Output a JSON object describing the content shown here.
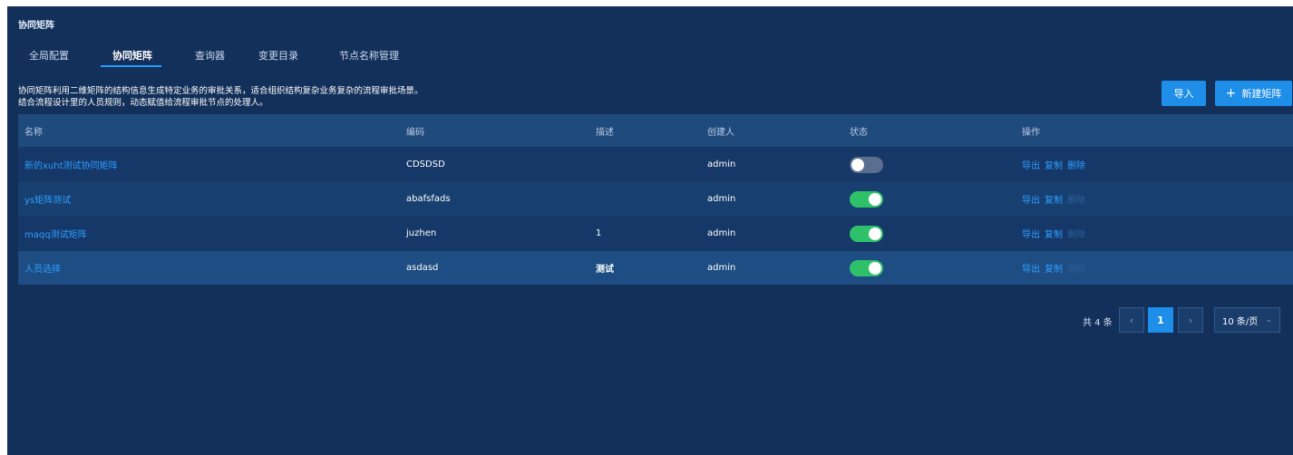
{
  "page": {
    "title": "协同矩阵"
  },
  "tabs": [
    {
      "label": "全局配置"
    },
    {
      "label": "协同矩阵",
      "active": true
    },
    {
      "label": "查询器"
    },
    {
      "label": "变更目录"
    },
    {
      "label": "节点名称管理"
    }
  ],
  "description": {
    "line1": "协同矩阵利用二维矩阵的结构信息生成特定业务的审批关系，适合组织结构复杂业务复杂的流程审批场景。",
    "line2": "结合流程设计里的人员规则，动态赋值给流程审批节点的处理人。"
  },
  "toolbar": {
    "import_label": "导入",
    "new_label": "新建矩阵",
    "new_icon": "plus-icon"
  },
  "table": {
    "columns": [
      "名称",
      "编码",
      "描述",
      "创建人",
      "状态",
      "操作"
    ],
    "rows": [
      {
        "name": "新的xuht测试协同矩阵",
        "code": "CDSDSD",
        "desc": "",
        "creator": "admin",
        "status": false,
        "ops": [
          "导出",
          "复制",
          "删除"
        ],
        "delete_enabled": true
      },
      {
        "name": "ys矩阵测试",
        "code": "abafsfads",
        "desc": "",
        "creator": "admin",
        "status": true,
        "ops": [
          "导出",
          "复制",
          "删除"
        ],
        "delete_enabled": false
      },
      {
        "name": "maqq测试矩阵",
        "code": "juzhen",
        "desc": "1",
        "creator": "admin",
        "status": true,
        "ops": [
          "导出",
          "复制",
          "删除"
        ],
        "delete_enabled": false
      },
      {
        "name": "人员选择",
        "code": "asdasd",
        "desc": "测试",
        "creator": "admin",
        "status": true,
        "ops": [
          "导出",
          "复制",
          "删除"
        ],
        "delete_enabled": false
      }
    ]
  },
  "pagination": {
    "total_label": "共 4 条",
    "prev_icon": "chevron-left-icon",
    "current_page": "1",
    "next_icon": "chevron-right-icon",
    "page_size": "10 条/页",
    "size_icon": "chevron-down-icon"
  },
  "colors": {
    "background": "#12305a",
    "accent": "#1e8ee8",
    "link": "#2f9dff",
    "toggle_on": "#2ec16a",
    "toggle_off": "#5a6f8f"
  }
}
